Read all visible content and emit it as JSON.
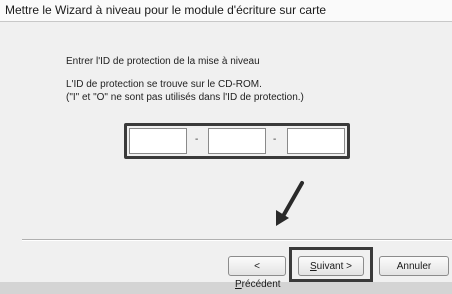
{
  "window": {
    "title": "Mettre le Wizard à niveau pour le module d'écriture sur carte"
  },
  "main": {
    "instruction": "Entrer l'ID de protection de la mise à niveau",
    "info_line1": "L'ID de protection se trouve sur le CD-ROM.",
    "info_line2": "(\"I\" et \"O\" ne sont pas utilisés dans l'ID de protection.)",
    "fields": [
      {
        "value": ""
      },
      {
        "value": ""
      },
      {
        "value": ""
      }
    ],
    "separator": "-"
  },
  "buttons": {
    "prev_prefix": "< ",
    "prev_key": "P",
    "prev_rest": "récédent",
    "next_key": "S",
    "next_rest": "uivant >",
    "cancel": "Annuler"
  },
  "colors": {
    "highlight": "#3a3a3a",
    "background": "#f0f0f0"
  }
}
